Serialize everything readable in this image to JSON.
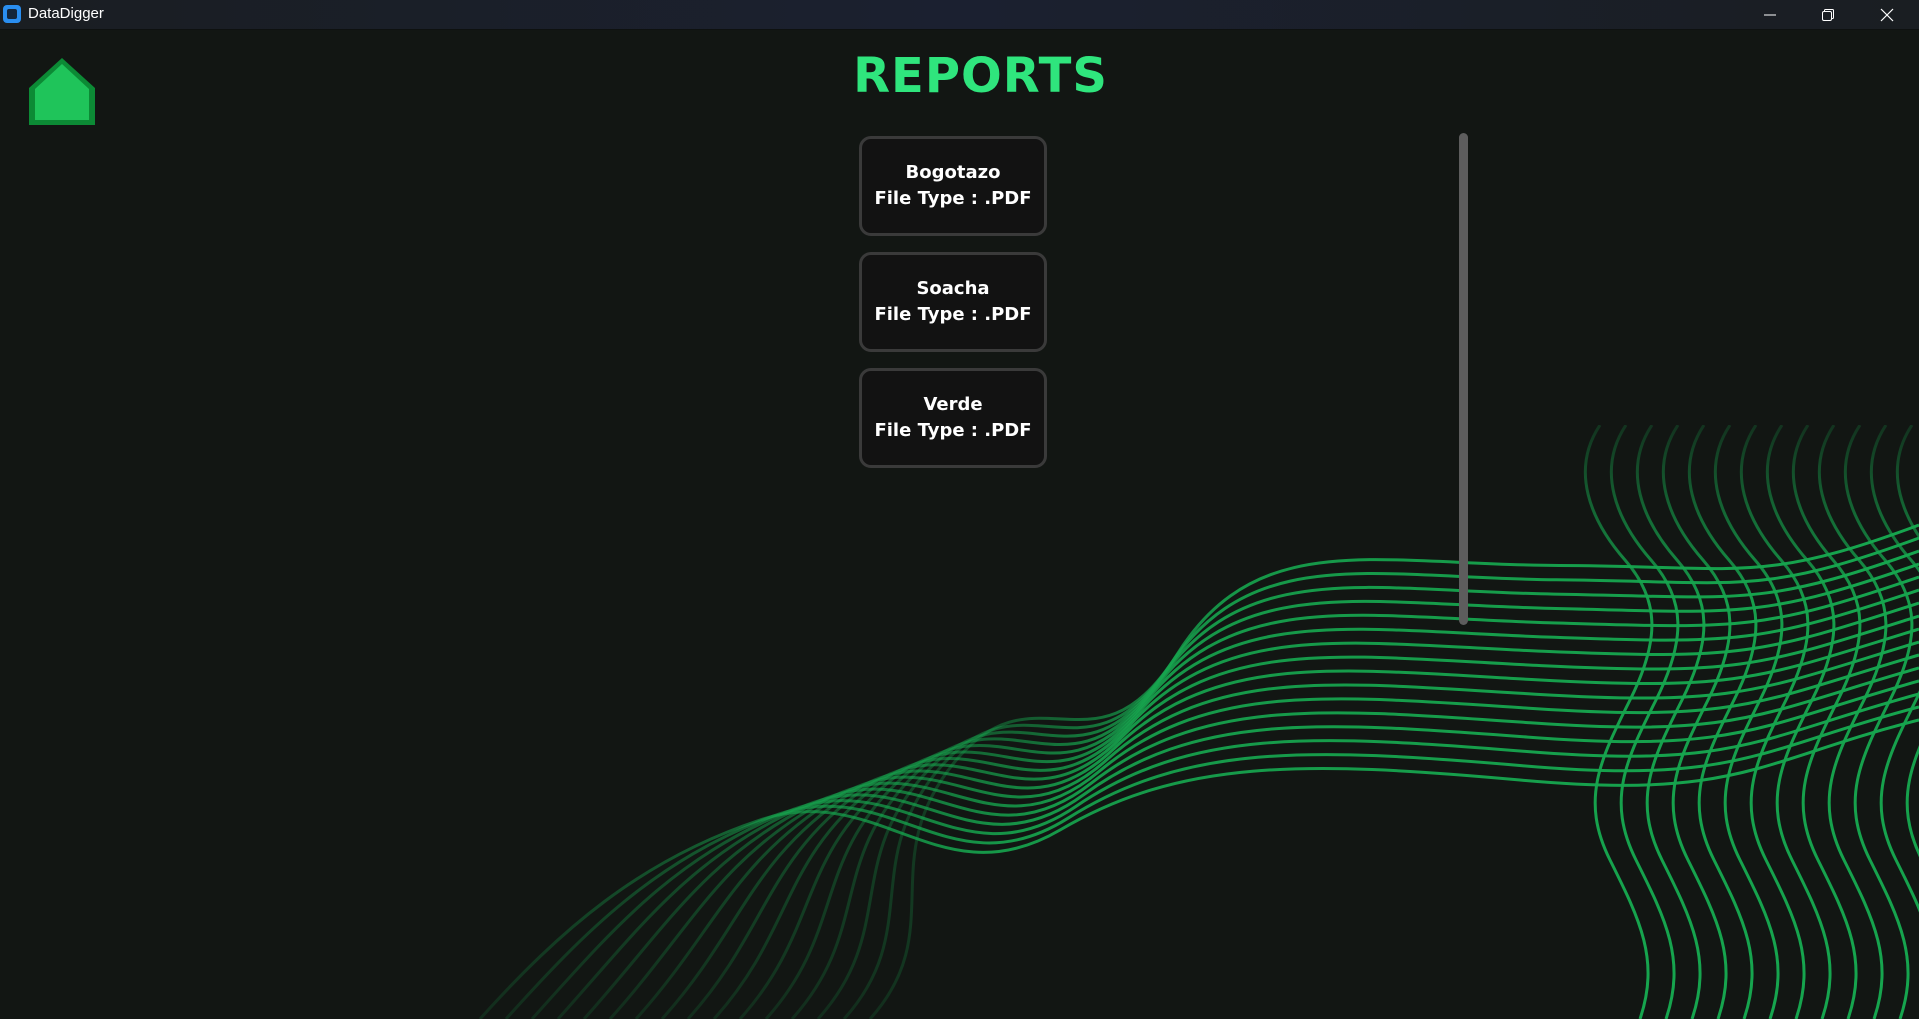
{
  "window": {
    "title": "DataDigger"
  },
  "header": {
    "title": "REPORTS"
  },
  "reports": [
    {
      "name": "Bogotazo",
      "file_type": "File Type : .PDF"
    },
    {
      "name": "Soacha",
      "file_type": "File Type : .PDF"
    },
    {
      "name": "Verde",
      "file_type": "File Type : .PDF"
    }
  ],
  "colors": {
    "background": "#121613",
    "accent": "#2fe57d",
    "wave": "#16a54e",
    "card_border": "#3a3a3a"
  },
  "icons": {
    "home": "home-icon",
    "minimize": "minimize-icon",
    "restore": "restore-icon",
    "close": "close-icon"
  }
}
